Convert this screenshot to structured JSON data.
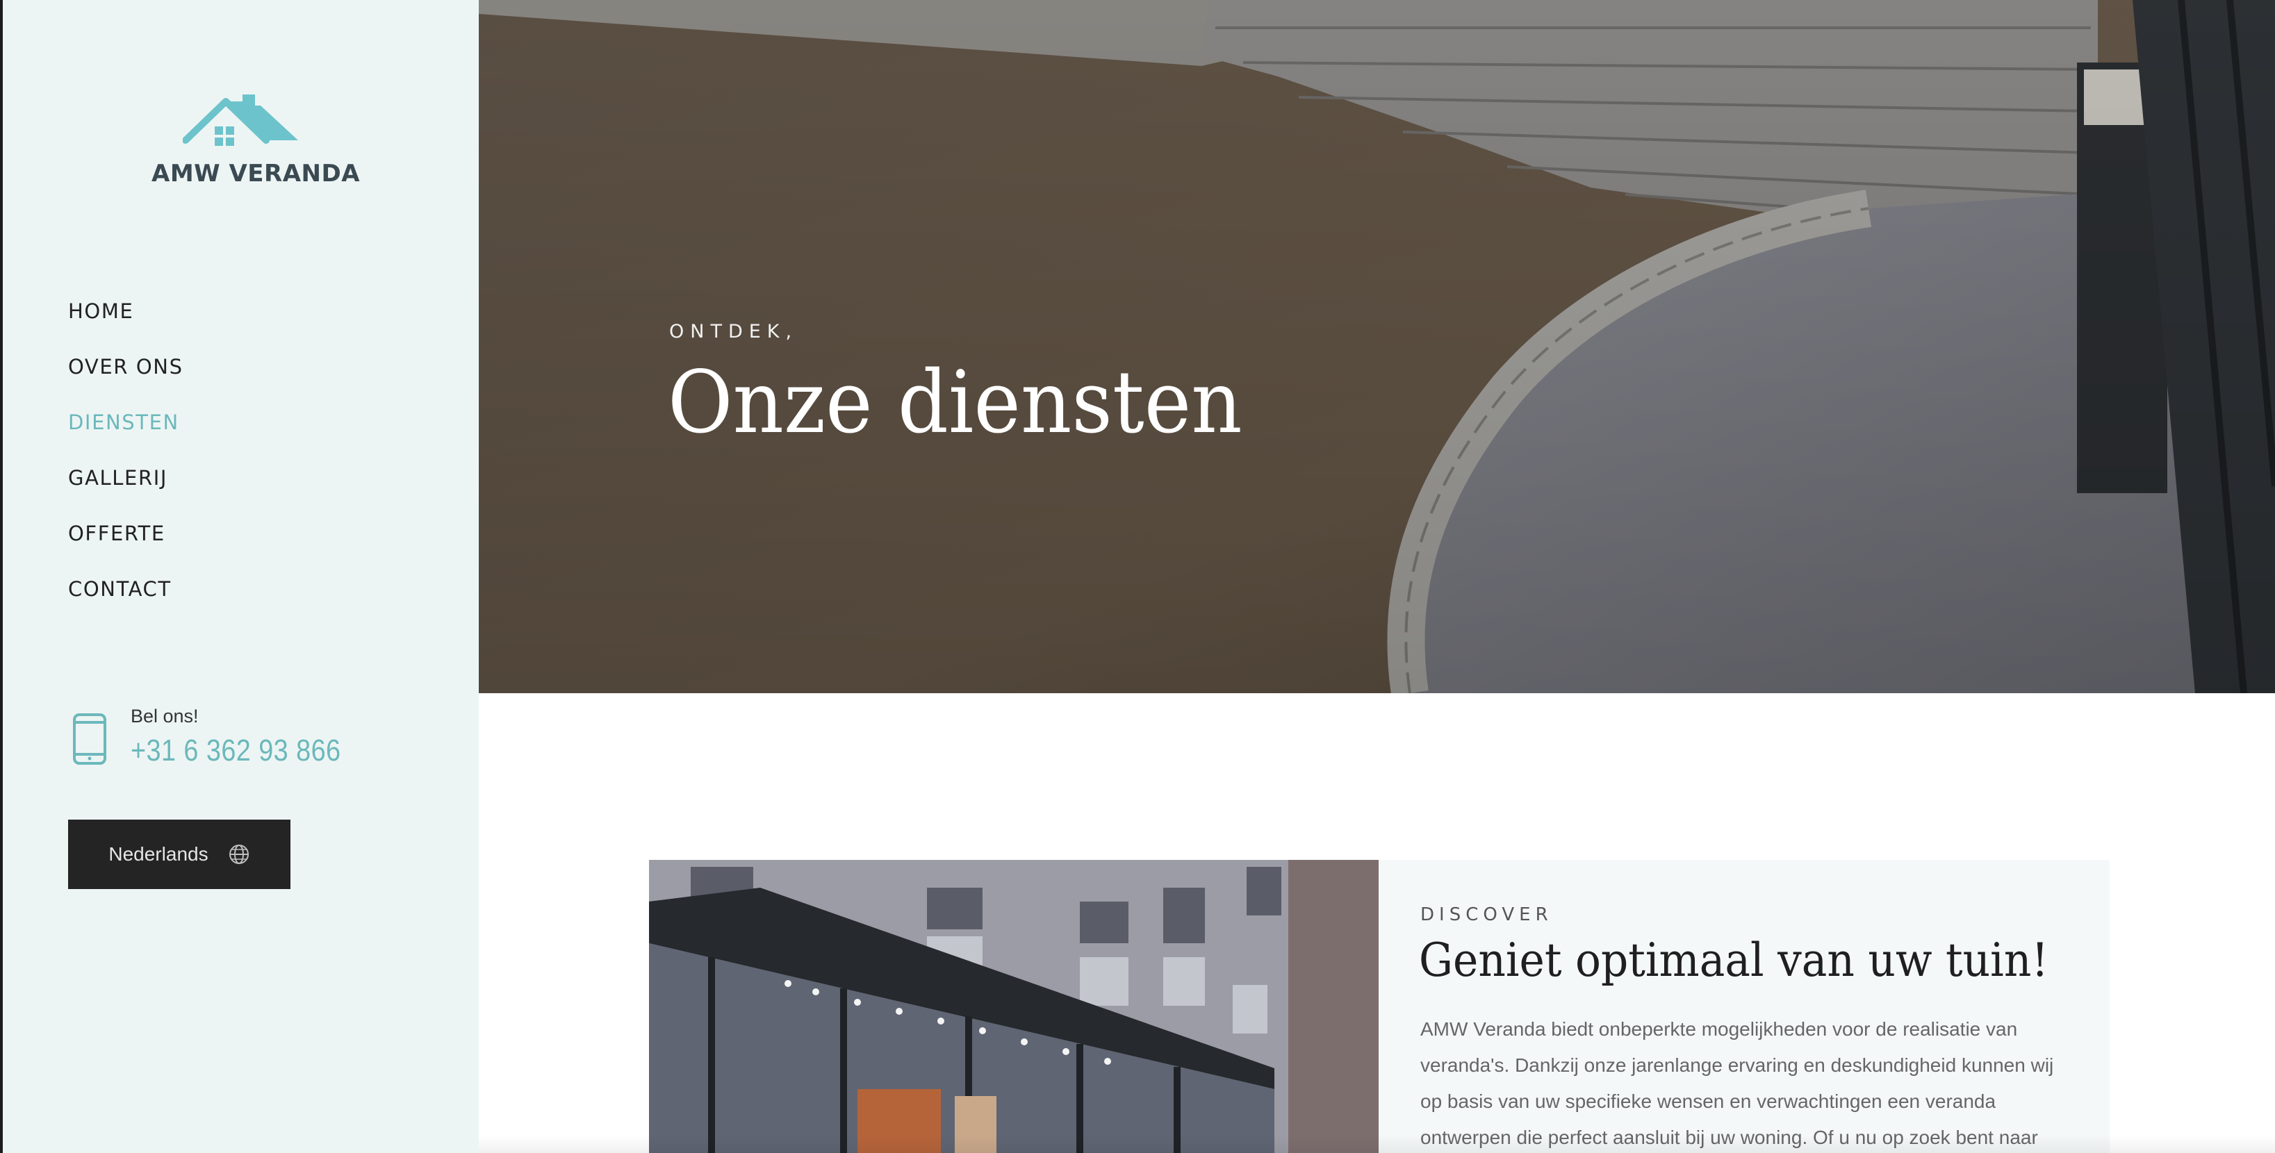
{
  "brand": {
    "name": "AMW VERANDA",
    "color": "#6cc3cb"
  },
  "nav": {
    "items": [
      {
        "label": "HOME"
      },
      {
        "label": "OVER ONS"
      },
      {
        "label": "DIENSTEN"
      },
      {
        "label": "GALLERIJ"
      },
      {
        "label": "OFFERTE"
      },
      {
        "label": "CONTACT"
      }
    ],
    "active": "DIENSTEN"
  },
  "contact": {
    "label": "Bel ons!",
    "phone": "+31 6 362 93 866",
    "icon": "phone-icon"
  },
  "language": {
    "label": "Nederlands",
    "icon": "globe-icon"
  },
  "hero": {
    "kicker": "ONTDEK,",
    "title": "Onze diensten"
  },
  "section": {
    "kicker": "DISCOVER",
    "title": "Geniet optimaal van uw tuin!",
    "body": "AMW Veranda biedt onbeperkte mogelijkheden voor de realisatie van veranda's. Dankzij onze jarenlange ervaring en deskundigheid kunnen wij op basis van uw specifieke wensen en verwachtingen een veranda ontwerpen die perfect aansluit bij uw woning. Of u nu op zoek bent naar een veranda in een traditioneel of modern"
  },
  "colors": {
    "accent": "#6cb8bb",
    "sidebar_bg": "#edf5f4",
    "button_bg": "#242424"
  }
}
